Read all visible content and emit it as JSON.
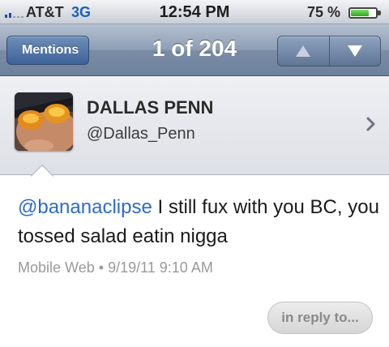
{
  "status_bar": {
    "carrier": "AT&T",
    "network": "3G",
    "time": "12:54 PM",
    "battery_percent": "75 %",
    "battery_level": 0.75
  },
  "nav_bar": {
    "back_label": "Mentions",
    "title": "1 of 204",
    "prev_icon": "triangle-up-icon",
    "next_icon": "triangle-down-icon"
  },
  "profile": {
    "name": "DALLAS PENN",
    "handle": "@Dallas_Penn"
  },
  "tweet": {
    "mention": "@bananaclipse",
    "text": " I still fux with you BC, you tossed salad eatin nigga",
    "source": "Mobile Web",
    "separator": "•",
    "timestamp": "9/19/11 9:10 AM"
  },
  "actions": {
    "reply_label": "in reply to..."
  },
  "colors": {
    "link": "#2d6bc8",
    "nav_accent": "#3d6399",
    "meta_text": "#9a9a9a"
  }
}
